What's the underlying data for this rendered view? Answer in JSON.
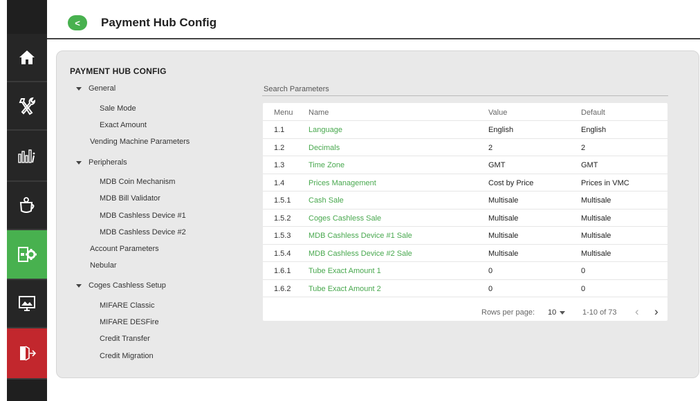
{
  "header": {
    "title": "Payment Hub Config",
    "back_label": "<"
  },
  "panel": {
    "title": "PAYMENT HUB CONFIG",
    "tree": [
      {
        "label": "General",
        "level": "group",
        "expanded": true
      },
      {
        "label": "Sale Mode",
        "level": "child"
      },
      {
        "label": "Exact Amount",
        "level": "child"
      },
      {
        "label": "Vending Machine Parameters",
        "level": "item"
      },
      {
        "label": "Peripherals",
        "level": "group",
        "expanded": true
      },
      {
        "label": "MDB Coin Mechanism",
        "level": "child"
      },
      {
        "label": "MDB Bill Validator",
        "level": "child"
      },
      {
        "label": "MDB Cashless Device #1",
        "level": "child"
      },
      {
        "label": "MDB Cashless Device #2",
        "level": "child"
      },
      {
        "label": "Account Parameters",
        "level": "item"
      },
      {
        "label": "Nebular",
        "level": "item"
      },
      {
        "label": "Coges Cashless Setup",
        "level": "group",
        "expanded": true
      },
      {
        "label": "MIFARE Classic",
        "level": "child"
      },
      {
        "label": "MIFARE DESFire",
        "level": "child"
      },
      {
        "label": "Credit Transfer",
        "level": "child"
      },
      {
        "label": "Credit Migration",
        "level": "child"
      }
    ]
  },
  "search": {
    "label": "Search Parameters"
  },
  "table": {
    "headers": {
      "menu": "Menu",
      "name": "Name",
      "value": "Value",
      "default": "Default"
    },
    "rows": [
      {
        "menu": "1.1",
        "name": "Language",
        "value": "English",
        "default": "English"
      },
      {
        "menu": "1.2",
        "name": "Decimals",
        "value": "2",
        "default": "2"
      },
      {
        "menu": "1.3",
        "name": "Time Zone",
        "value": "GMT",
        "default": "GMT"
      },
      {
        "menu": "1.4",
        "name": "Prices Management",
        "value": "Cost by Price",
        "default": "Prices in VMC"
      },
      {
        "menu": "1.5.1",
        "name": "Cash Sale",
        "value": "Multisale",
        "default": "Multisale"
      },
      {
        "menu": "1.5.2",
        "name": "Coges Cashless Sale",
        "value": "Multisale",
        "default": "Multisale"
      },
      {
        "menu": "1.5.3",
        "name": "MDB Cashless Device #1 Sale",
        "value": "Multisale",
        "default": "Multisale"
      },
      {
        "menu": "1.5.4",
        "name": "MDB Cashless Device #2 Sale",
        "value": "Multisale",
        "default": "Multisale"
      },
      {
        "menu": "1.6.1",
        "name": "Tube Exact Amount 1",
        "value": "0",
        "default": "0"
      },
      {
        "menu": "1.6.2",
        "name": "Tube Exact Amount 2",
        "value": "0",
        "default": "0"
      }
    ],
    "footer": {
      "rows_per_page_label": "Rows per page:",
      "rows_per_page": "10",
      "range": "1-10 of 73",
      "prev": "‹",
      "next": "›"
    }
  },
  "nav": [
    {
      "icon": "home-icon",
      "state": "normal"
    },
    {
      "icon": "tools-icon",
      "state": "normal"
    },
    {
      "icon": "statistics-icon",
      "state": "normal"
    },
    {
      "icon": "coffee-settings-icon",
      "state": "normal"
    },
    {
      "icon": "payment-settings-icon",
      "state": "active"
    },
    {
      "icon": "display-icon",
      "state": "normal"
    },
    {
      "icon": "exit-icon",
      "state": "exit"
    }
  ],
  "colors": {
    "accent": "#48b14f",
    "exit": "#c2272d",
    "sidebar": "#1f1f1f",
    "panel": "#e9e9e9"
  }
}
